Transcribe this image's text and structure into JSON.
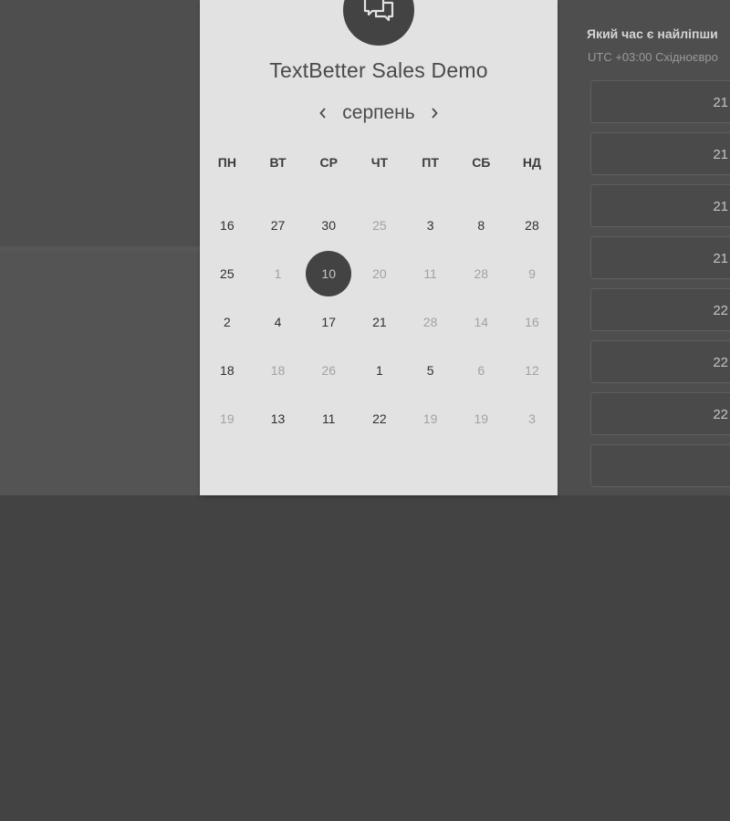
{
  "event": {
    "title": "TextBetter Sales Demo",
    "logo_icon": "chat-bubbles-icon"
  },
  "calendar": {
    "month": "серпень",
    "prev_icon": "chevron-left-icon",
    "next_icon": "chevron-right-icon",
    "weekdays": [
      "ПН",
      "ВТ",
      "СР",
      "ЧТ",
      "ПТ",
      "СБ",
      "НД"
    ],
    "weeks": [
      [
        {
          "d": "16",
          "en": true
        },
        {
          "d": "27",
          "en": true
        },
        {
          "d": "30",
          "en": true
        },
        {
          "d": "25",
          "en": false
        },
        {
          "d": "3",
          "en": true
        },
        {
          "d": "8",
          "en": true
        },
        {
          "d": "28",
          "en": true
        }
      ],
      [
        {
          "d": "25",
          "en": true
        },
        {
          "d": "1",
          "en": false
        },
        {
          "d": "10",
          "en": true,
          "selected": true
        },
        {
          "d": "20",
          "en": false
        },
        {
          "d": "11",
          "en": false
        },
        {
          "d": "28",
          "en": false
        },
        {
          "d": "9",
          "en": false
        }
      ],
      [
        {
          "d": "2",
          "en": true
        },
        {
          "d": "4",
          "en": true
        },
        {
          "d": "17",
          "en": true
        },
        {
          "d": "21",
          "en": true
        },
        {
          "d": "28",
          "en": false
        },
        {
          "d": "14",
          "en": false
        },
        {
          "d": "16",
          "en": false
        }
      ],
      [
        {
          "d": "18",
          "en": true
        },
        {
          "d": "18",
          "en": false
        },
        {
          "d": "26",
          "en": false
        },
        {
          "d": "1",
          "en": true
        },
        {
          "d": "5",
          "en": true
        },
        {
          "d": "6",
          "en": false
        },
        {
          "d": "12",
          "en": false
        }
      ],
      [
        {
          "d": "19",
          "en": false
        },
        {
          "d": "13",
          "en": true
        },
        {
          "d": "11",
          "en": true
        },
        {
          "d": "22",
          "en": true
        },
        {
          "d": "19",
          "en": false
        },
        {
          "d": "19",
          "en": false
        },
        {
          "d": "3",
          "en": false
        }
      ]
    ]
  },
  "times": {
    "title": "Який час є найліпши",
    "timezone": "UTC +03:00 Східноєвро",
    "slots": [
      "21",
      "21",
      "21",
      "21",
      "22",
      "22",
      "22",
      ""
    ]
  },
  "colors": {
    "accent": "#434343",
    "panel": "#e2e2e2"
  }
}
